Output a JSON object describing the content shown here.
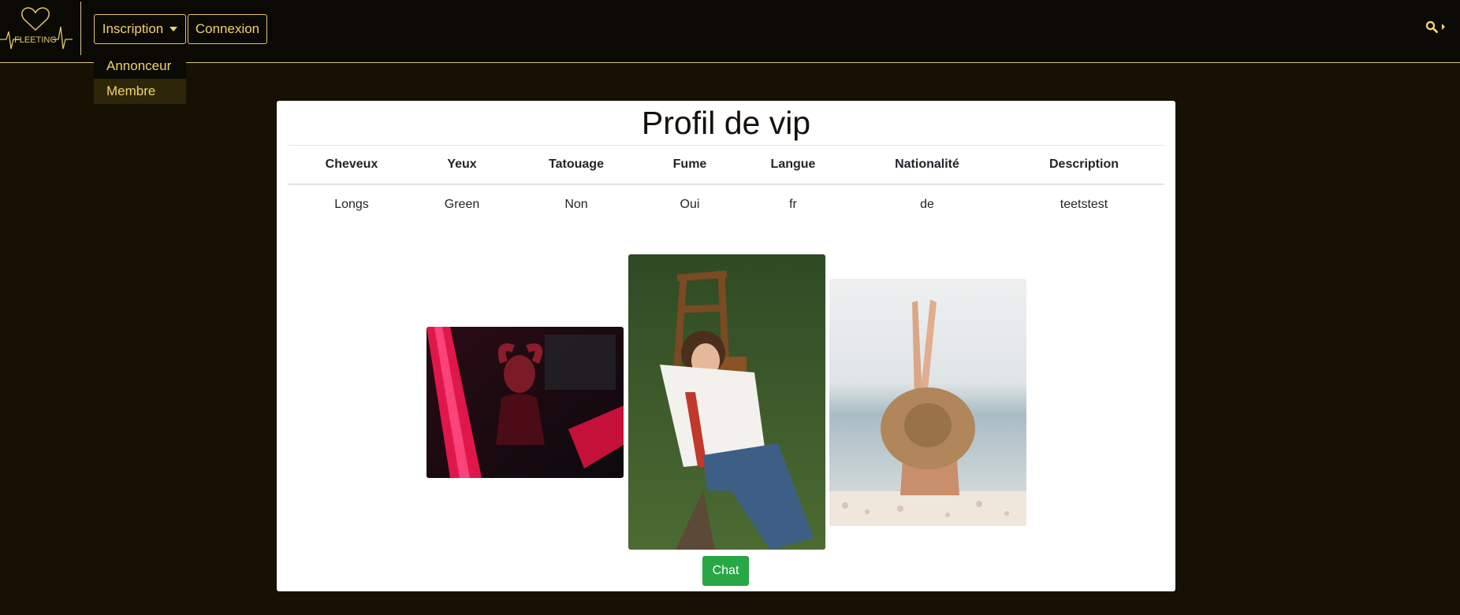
{
  "brand": {
    "logo_text": "FLEETING"
  },
  "nav": {
    "inscription_label": "Inscription",
    "connexion_label": "Connexion",
    "search_icon": "search-icon",
    "dropdown_items": [
      {
        "label": "Annonceur",
        "active": false
      },
      {
        "label": "Membre",
        "active": true
      }
    ]
  },
  "profile": {
    "title": "Profil de vip",
    "columns": [
      "Cheveux",
      "Yeux",
      "Tatouage",
      "Fume",
      "Langue",
      "Nationalité",
      "Description"
    ],
    "row": [
      "Longs",
      "Green",
      "Non",
      "Oui",
      "fr",
      "de",
      "teetstest"
    ],
    "photos": [
      "photo-woman-red-light",
      "photo-woman-on-grass-chair",
      "photo-woman-sunhat-beach"
    ],
    "chat_label": "Chat"
  },
  "colors": {
    "accent": "#f2d36c",
    "background": "#171104",
    "navbar": "#0b0904",
    "chat_button": "#28a745"
  }
}
